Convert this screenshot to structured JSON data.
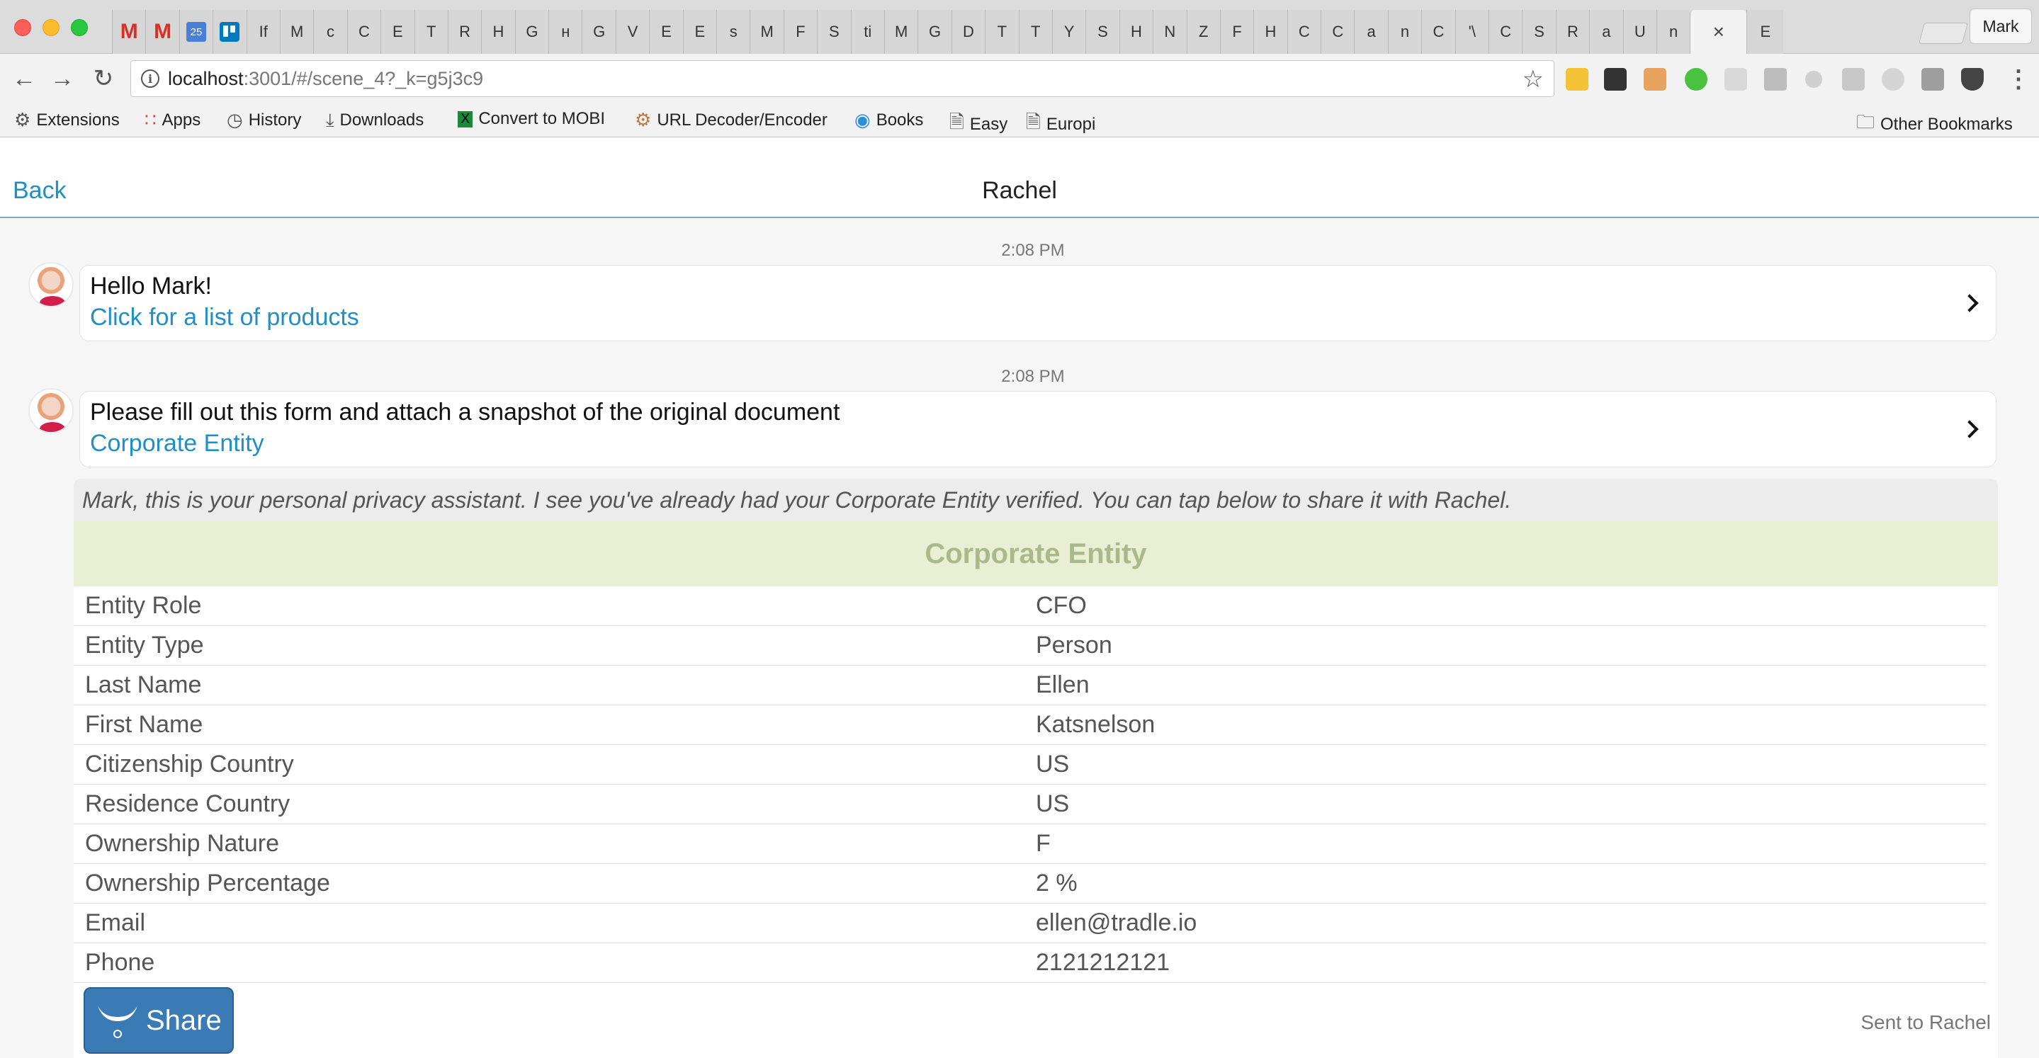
{
  "browser": {
    "tabs": [
      {
        "label": "M",
        "kind": "gmail"
      },
      {
        "label": "M",
        "kind": "gmail"
      },
      {
        "label": "25",
        "kind": "calendar"
      },
      {
        "label": "",
        "kind": "trello"
      },
      {
        "label": "If",
        "kind": "text"
      },
      {
        "label": "M",
        "kind": "text"
      },
      {
        "label": "c",
        "kind": "text"
      },
      {
        "label": "C",
        "kind": "text"
      },
      {
        "label": "E",
        "kind": "text"
      },
      {
        "label": "T",
        "kind": "text"
      },
      {
        "label": "R",
        "kind": "text"
      },
      {
        "label": "H",
        "kind": "text"
      },
      {
        "label": "G",
        "kind": "text"
      },
      {
        "label": "н",
        "kind": "text"
      },
      {
        "label": "G",
        "kind": "text"
      },
      {
        "label": "V",
        "kind": "text"
      },
      {
        "label": "E",
        "kind": "text"
      },
      {
        "label": "E",
        "kind": "text"
      },
      {
        "label": "s",
        "kind": "text"
      },
      {
        "label": "M",
        "kind": "text"
      },
      {
        "label": "F",
        "kind": "text"
      },
      {
        "label": "S",
        "kind": "text"
      },
      {
        "label": "ti",
        "kind": "text"
      },
      {
        "label": "M",
        "kind": "text"
      },
      {
        "label": "G",
        "kind": "text"
      },
      {
        "label": "D",
        "kind": "text"
      },
      {
        "label": "T",
        "kind": "text"
      },
      {
        "label": "T",
        "kind": "text"
      },
      {
        "label": "Y",
        "kind": "text"
      },
      {
        "label": "S",
        "kind": "text"
      },
      {
        "label": "H",
        "kind": "text"
      },
      {
        "label": "N",
        "kind": "text"
      },
      {
        "label": "Z",
        "kind": "text"
      },
      {
        "label": "F",
        "kind": "text"
      },
      {
        "label": "H",
        "kind": "text"
      },
      {
        "label": "C",
        "kind": "text"
      },
      {
        "label": "C",
        "kind": "text"
      },
      {
        "label": "a",
        "kind": "text"
      },
      {
        "label": "n",
        "kind": "text"
      },
      {
        "label": "C",
        "kind": "text"
      },
      {
        "label": "'\\",
        "kind": "text"
      },
      {
        "label": "C",
        "kind": "text"
      },
      {
        "label": "S",
        "kind": "text"
      },
      {
        "label": "R",
        "kind": "text"
      },
      {
        "label": "a",
        "kind": "text"
      },
      {
        "label": "U",
        "kind": "text"
      },
      {
        "label": "n",
        "kind": "text"
      }
    ],
    "active_tab_close": "×",
    "trailing_tab": "E",
    "profile_name": "Mark",
    "url_host": "localhost",
    "url_path": ":3001/#/scene_4?_k=g5j3c9",
    "star_icon": "☆",
    "bookmarks": [
      {
        "label": "Extensions",
        "icon": "puzzle-icon"
      },
      {
        "label": "Apps",
        "icon": "apps-grid-icon"
      },
      {
        "label": "History",
        "icon": "history-icon"
      },
      {
        "label": "Downloads",
        "icon": "download-icon"
      },
      {
        "label": "Convert to MOBI",
        "icon": "mobi-icon"
      },
      {
        "label": "URL Decoder/Encoder",
        "icon": "url-tool-icon"
      },
      {
        "label": "Books",
        "icon": "books-icon"
      },
      {
        "label": "Easy",
        "icon": "page-icon"
      },
      {
        "label": "Europi",
        "icon": "page-icon"
      }
    ],
    "other_bookmarks": "Other Bookmarks"
  },
  "app": {
    "back_label": "Back",
    "title": "Rachel",
    "messages": [
      {
        "timestamp": "2:08 PM",
        "text": "Hello Mark!",
        "link": "Click for a list of products"
      },
      {
        "timestamp": "2:08 PM",
        "text": "Please fill out this form and attach a snapshot of the original document",
        "link": "Corporate Entity"
      }
    ],
    "card": {
      "note": "Mark, this is your personal privacy assistant. I see you've already had your Corporate Entity verified. You can tap below to share it with Rachel.",
      "title": "Corporate Entity",
      "fields": [
        {
          "label": "Entity Role",
          "value": "CFO"
        },
        {
          "label": "Entity Type",
          "value": "Person"
        },
        {
          "label": "Last Name",
          "value": "Ellen"
        },
        {
          "label": "First Name",
          "value": "Katsnelson"
        },
        {
          "label": "Citizenship Country",
          "value": "US"
        },
        {
          "label": "Residence Country",
          "value": "US"
        },
        {
          "label": "Ownership Nature",
          "value": "F"
        },
        {
          "label": "Ownership Percentage",
          "value": "2 %"
        },
        {
          "label": "Email",
          "value": "ellen@tradle.io"
        },
        {
          "label": "Phone",
          "value": "2121212121"
        }
      ],
      "share_label": "Share",
      "sent_status": "Sent to Rachel"
    }
  },
  "colors": {
    "link": "#1f8fc8",
    "share_button": "#3a7ab5",
    "card_title_bg": "#e8efd3",
    "card_title_text": "#a9b98c"
  }
}
